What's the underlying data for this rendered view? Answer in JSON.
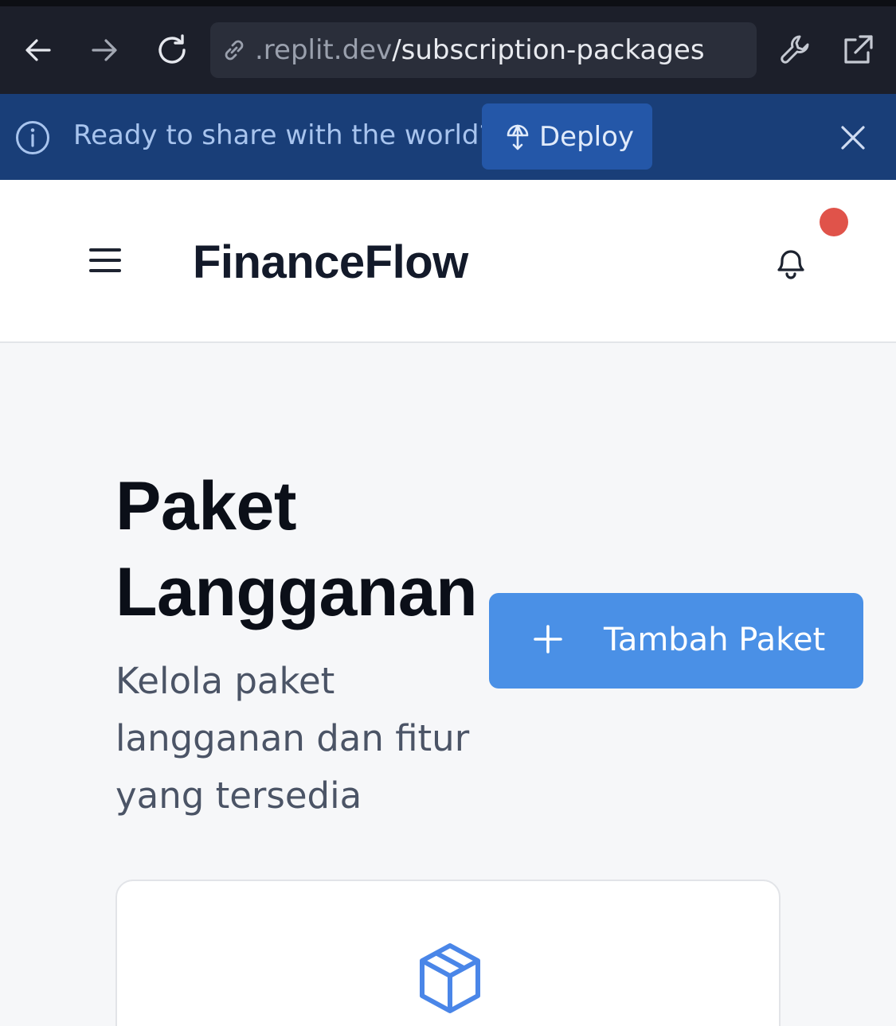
{
  "browser": {
    "url_domain": ".replit.dev",
    "url_path": "/subscription-packages"
  },
  "banner": {
    "message": "Ready to share with the world?",
    "deploy_label": "Deploy"
  },
  "header": {
    "brand": "FinanceFlow",
    "has_notification": true
  },
  "page": {
    "title_line1": "Paket",
    "title_line2": "Langganan",
    "subtitle": "Kelola paket langganan dan fitur yang tersedia",
    "add_button_label": "Tambah Paket"
  },
  "icons": [
    "arrow-left-icon",
    "arrow-right-icon",
    "reload-icon",
    "link-icon",
    "wrench-icon",
    "external-link-icon",
    "info-icon",
    "deploy-icon",
    "close-icon",
    "menu-icon",
    "bell-icon",
    "plus-icon",
    "package-icon"
  ],
  "colors": {
    "accent": "#4a90e6",
    "banner": "#193e78",
    "notification": "#e0534a"
  }
}
